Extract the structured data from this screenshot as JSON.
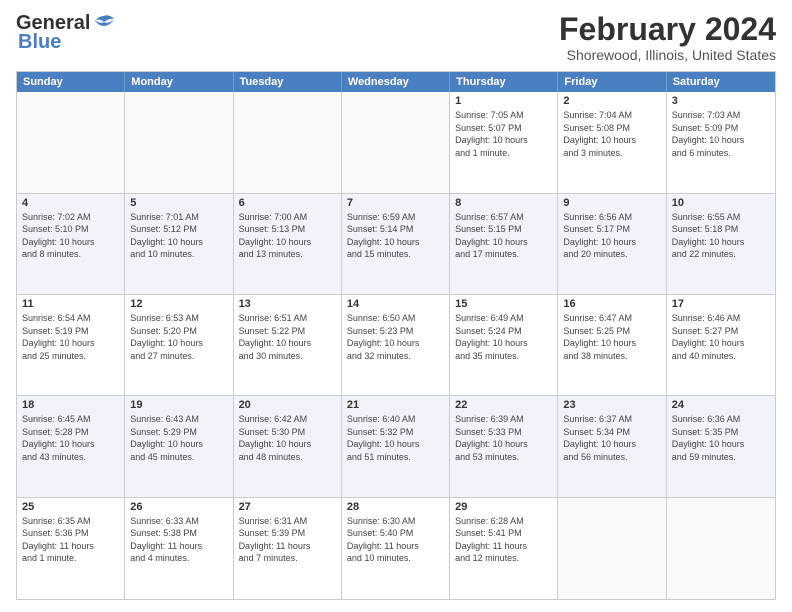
{
  "header": {
    "logo_line1": "General",
    "logo_line2": "Blue",
    "month_title": "February 2024",
    "location": "Shorewood, Illinois, United States"
  },
  "weekdays": [
    "Sunday",
    "Monday",
    "Tuesday",
    "Wednesday",
    "Thursday",
    "Friday",
    "Saturday"
  ],
  "rows": [
    [
      {
        "day": "",
        "info": "",
        "empty": true
      },
      {
        "day": "",
        "info": "",
        "empty": true
      },
      {
        "day": "",
        "info": "",
        "empty": true
      },
      {
        "day": "",
        "info": "",
        "empty": true
      },
      {
        "day": "1",
        "info": "Sunrise: 7:05 AM\nSunset: 5:07 PM\nDaylight: 10 hours\nand 1 minute."
      },
      {
        "day": "2",
        "info": "Sunrise: 7:04 AM\nSunset: 5:08 PM\nDaylight: 10 hours\nand 3 minutes."
      },
      {
        "day": "3",
        "info": "Sunrise: 7:03 AM\nSunset: 5:09 PM\nDaylight: 10 hours\nand 6 minutes."
      }
    ],
    [
      {
        "day": "4",
        "info": "Sunrise: 7:02 AM\nSunset: 5:10 PM\nDaylight: 10 hours\nand 8 minutes.",
        "alt": true
      },
      {
        "day": "5",
        "info": "Sunrise: 7:01 AM\nSunset: 5:12 PM\nDaylight: 10 hours\nand 10 minutes.",
        "alt": true
      },
      {
        "day": "6",
        "info": "Sunrise: 7:00 AM\nSunset: 5:13 PM\nDaylight: 10 hours\nand 13 minutes.",
        "alt": true
      },
      {
        "day": "7",
        "info": "Sunrise: 6:59 AM\nSunset: 5:14 PM\nDaylight: 10 hours\nand 15 minutes.",
        "alt": true
      },
      {
        "day": "8",
        "info": "Sunrise: 6:57 AM\nSunset: 5:15 PM\nDaylight: 10 hours\nand 17 minutes.",
        "alt": true
      },
      {
        "day": "9",
        "info": "Sunrise: 6:56 AM\nSunset: 5:17 PM\nDaylight: 10 hours\nand 20 minutes.",
        "alt": true
      },
      {
        "day": "10",
        "info": "Sunrise: 6:55 AM\nSunset: 5:18 PM\nDaylight: 10 hours\nand 22 minutes.",
        "alt": true
      }
    ],
    [
      {
        "day": "11",
        "info": "Sunrise: 6:54 AM\nSunset: 5:19 PM\nDaylight: 10 hours\nand 25 minutes."
      },
      {
        "day": "12",
        "info": "Sunrise: 6:53 AM\nSunset: 5:20 PM\nDaylight: 10 hours\nand 27 minutes."
      },
      {
        "day": "13",
        "info": "Sunrise: 6:51 AM\nSunset: 5:22 PM\nDaylight: 10 hours\nand 30 minutes."
      },
      {
        "day": "14",
        "info": "Sunrise: 6:50 AM\nSunset: 5:23 PM\nDaylight: 10 hours\nand 32 minutes."
      },
      {
        "day": "15",
        "info": "Sunrise: 6:49 AM\nSunset: 5:24 PM\nDaylight: 10 hours\nand 35 minutes."
      },
      {
        "day": "16",
        "info": "Sunrise: 6:47 AM\nSunset: 5:25 PM\nDaylight: 10 hours\nand 38 minutes."
      },
      {
        "day": "17",
        "info": "Sunrise: 6:46 AM\nSunset: 5:27 PM\nDaylight: 10 hours\nand 40 minutes."
      }
    ],
    [
      {
        "day": "18",
        "info": "Sunrise: 6:45 AM\nSunset: 5:28 PM\nDaylight: 10 hours\nand 43 minutes.",
        "alt": true
      },
      {
        "day": "19",
        "info": "Sunrise: 6:43 AM\nSunset: 5:29 PM\nDaylight: 10 hours\nand 45 minutes.",
        "alt": true
      },
      {
        "day": "20",
        "info": "Sunrise: 6:42 AM\nSunset: 5:30 PM\nDaylight: 10 hours\nand 48 minutes.",
        "alt": true
      },
      {
        "day": "21",
        "info": "Sunrise: 6:40 AM\nSunset: 5:32 PM\nDaylight: 10 hours\nand 51 minutes.",
        "alt": true
      },
      {
        "day": "22",
        "info": "Sunrise: 6:39 AM\nSunset: 5:33 PM\nDaylight: 10 hours\nand 53 minutes.",
        "alt": true
      },
      {
        "day": "23",
        "info": "Sunrise: 6:37 AM\nSunset: 5:34 PM\nDaylight: 10 hours\nand 56 minutes.",
        "alt": true
      },
      {
        "day": "24",
        "info": "Sunrise: 6:36 AM\nSunset: 5:35 PM\nDaylight: 10 hours\nand 59 minutes.",
        "alt": true
      }
    ],
    [
      {
        "day": "25",
        "info": "Sunrise: 6:35 AM\nSunset: 5:36 PM\nDaylight: 11 hours\nand 1 minute."
      },
      {
        "day": "26",
        "info": "Sunrise: 6:33 AM\nSunset: 5:38 PM\nDaylight: 11 hours\nand 4 minutes."
      },
      {
        "day": "27",
        "info": "Sunrise: 6:31 AM\nSunset: 5:39 PM\nDaylight: 11 hours\nand 7 minutes."
      },
      {
        "day": "28",
        "info": "Sunrise: 6:30 AM\nSunset: 5:40 PM\nDaylight: 11 hours\nand 10 minutes."
      },
      {
        "day": "29",
        "info": "Sunrise: 6:28 AM\nSunset: 5:41 PM\nDaylight: 11 hours\nand 12 minutes."
      },
      {
        "day": "",
        "info": "",
        "empty": true
      },
      {
        "day": "",
        "info": "",
        "empty": true
      }
    ]
  ]
}
